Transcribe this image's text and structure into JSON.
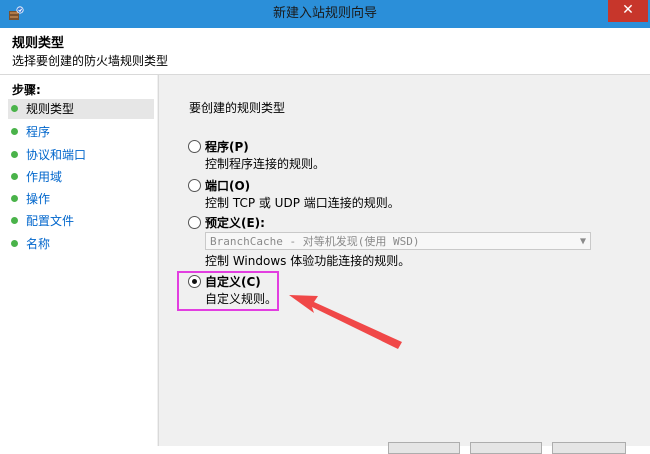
{
  "window": {
    "title": "新建入站规则向导",
    "close_glyph": "✕",
    "app_icon": "firewall-rule-icon"
  },
  "header": {
    "title": "规则类型",
    "subtitle": "选择要创建的防火墙规则类型"
  },
  "steps": {
    "label": "步骤:",
    "items": [
      {
        "label": "规则类型",
        "current": true
      },
      {
        "label": "程序",
        "current": false
      },
      {
        "label": "协议和端口",
        "current": false
      },
      {
        "label": "作用域",
        "current": false
      },
      {
        "label": "操作",
        "current": false
      },
      {
        "label": "配置文件",
        "current": false
      },
      {
        "label": "名称",
        "current": false
      }
    ]
  },
  "content": {
    "question": "要创建的规则类型",
    "options": [
      {
        "label": "程序(P)",
        "desc": "控制程序连接的规则。",
        "checked": false
      },
      {
        "label": "端口(O)",
        "desc": "控制 TCP 或 UDP 端口连接的规则。",
        "checked": false
      },
      {
        "label": "预定义(E):",
        "desc": "控制 Windows 体验功能连接的规则。",
        "checked": false
      },
      {
        "label": "自定义(C)",
        "desc": "自定义规则。",
        "checked": true
      }
    ],
    "predefined_select_value": "BranchCache - 对等机发现(使用 WSD)"
  },
  "colors": {
    "title_bar": "#2b8fd9",
    "close_button": "#c7362b",
    "highlight": "#e23ee0",
    "arrow": "#f04848",
    "step_link": "#0066cc",
    "step_dot": "#4ab34a"
  }
}
